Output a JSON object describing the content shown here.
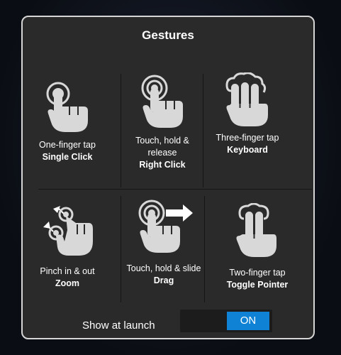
{
  "dialog": {
    "title": "Gestures"
  },
  "gestures": [
    {
      "icon": "one-finger-tap-icon",
      "label": "One-finger tap",
      "action": "Single Click"
    },
    {
      "icon": "touch-hold-release-icon",
      "label": "Touch, hold & release",
      "action": "Right Click"
    },
    {
      "icon": "three-finger-tap-icon",
      "label": "Three-finger tap",
      "action": "Keyboard"
    },
    {
      "icon": "pinch-icon",
      "label": "Pinch in & out",
      "action": "Zoom"
    },
    {
      "icon": "touch-hold-slide-icon",
      "label": "Touch, hold & slide",
      "action": "Drag"
    },
    {
      "icon": "two-finger-tap-icon",
      "label": "Two-finger tap",
      "action": "Toggle Pointer"
    }
  ],
  "launch": {
    "label": "Show at launch",
    "toggle_value": "ON"
  },
  "colors": {
    "dialog_bg": "#2a2a2a",
    "toggle_on": "#0f82d6",
    "icon": "#d8d8d8"
  }
}
